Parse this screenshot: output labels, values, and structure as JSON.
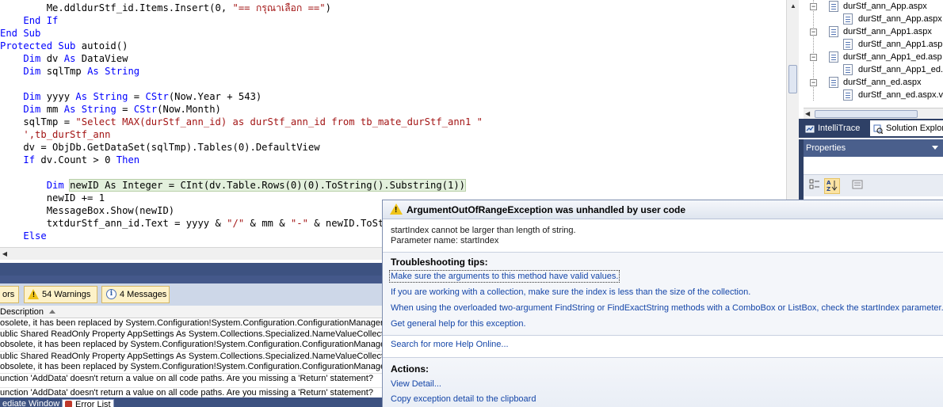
{
  "editor": {
    "lines": [
      [
        {
          "t": "        Me.ddldurStf_id.Items.Insert(0, "
        },
        {
          "t": "\"== กรุณาเลือก ==\"",
          "c": "str"
        },
        {
          "t": ")"
        }
      ],
      [
        {
          "t": "    "
        },
        {
          "t": "End If",
          "c": "kw"
        }
      ],
      [
        {
          "t": "End Sub",
          "c": "kw"
        }
      ],
      [
        {
          "t": "Protected Sub",
          "c": "kw"
        },
        {
          "t": " autoid()"
        }
      ],
      [
        {
          "t": "    "
        },
        {
          "t": "Dim",
          "c": "kw"
        },
        {
          "t": " dv "
        },
        {
          "t": "As",
          "c": "kw"
        },
        {
          "t": " DataView"
        }
      ],
      [
        {
          "t": "    "
        },
        {
          "t": "Dim",
          "c": "kw"
        },
        {
          "t": " sqlTmp "
        },
        {
          "t": "As",
          "c": "kw"
        },
        {
          "t": " "
        },
        {
          "t": "String",
          "c": "kw"
        }
      ],
      [
        {
          "t": ""
        }
      ],
      [
        {
          "t": "    "
        },
        {
          "t": "Dim",
          "c": "kw"
        },
        {
          "t": " yyyy "
        },
        {
          "t": "As",
          "c": "kw"
        },
        {
          "t": " "
        },
        {
          "t": "String",
          "c": "kw"
        },
        {
          "t": " = "
        },
        {
          "t": "CStr",
          "c": "kw"
        },
        {
          "t": "(Now.Year + 543)"
        }
      ],
      [
        {
          "t": "    "
        },
        {
          "t": "Dim",
          "c": "kw"
        },
        {
          "t": " mm "
        },
        {
          "t": "As",
          "c": "kw"
        },
        {
          "t": " "
        },
        {
          "t": "String",
          "c": "kw"
        },
        {
          "t": " = "
        },
        {
          "t": "CStr",
          "c": "kw"
        },
        {
          "t": "(Now.Month)"
        }
      ],
      [
        {
          "t": "    sqlTmp = "
        },
        {
          "t": "\"Select MAX(durStf_ann_id) as durStf_ann_id from tb_mate_durStf_ann1 \"",
          "c": "str"
        }
      ],
      [
        {
          "t": "    "
        },
        {
          "t": "',tb_durStf_ann",
          "c": "str"
        }
      ],
      [
        {
          "t": "    dv = ObjDb.GetDataSet(sqlTmp).Tables(0).DefaultView"
        }
      ],
      [
        {
          "t": "    "
        },
        {
          "t": "If",
          "c": "kw"
        },
        {
          "t": " dv.Count > 0 "
        },
        {
          "t": "Then",
          "c": "kw"
        }
      ],
      [
        {
          "t": ""
        }
      ],
      [
        {
          "t": "        "
        },
        {
          "t": "Dim",
          "c": "kw"
        },
        {
          "t": " "
        },
        {
          "t": "newID As Integer = CInt(dv.Table.Rows(0)(0).ToString().Substring(1))",
          "c": "hl"
        }
      ],
      [
        {
          "t": "        newID += 1"
        }
      ],
      [
        {
          "t": "        MessageBox.Show(newID)"
        }
      ],
      [
        {
          "t": "        txtdurStf_ann_id.Text = yyyy & "
        },
        {
          "t": "\"/\"",
          "c": "str"
        },
        {
          "t": " & mm & "
        },
        {
          "t": "\"-\"",
          "c": "str"
        },
        {
          "t": " & newID.ToStr"
        }
      ],
      [
        {
          "t": "    "
        },
        {
          "t": "Else",
          "c": "kw"
        }
      ]
    ]
  },
  "solution_explorer": {
    "items": [
      {
        "label": "durStf_ann_App.aspx",
        "toggle": "-",
        "indent": 1
      },
      {
        "label": "durStf_ann_App.aspx",
        "toggle": "",
        "indent": 2
      },
      {
        "label": "durStf_ann_App1.aspx",
        "toggle": "-",
        "indent": 1
      },
      {
        "label": "durStf_ann_App1.asp",
        "toggle": "",
        "indent": 2
      },
      {
        "label": "durStf_ann_App1_ed.asp",
        "toggle": "-",
        "indent": 1
      },
      {
        "label": "durStf_ann_App1_ed.",
        "toggle": "",
        "indent": 2
      },
      {
        "label": "durStf_ann_ed.aspx",
        "toggle": "-",
        "indent": 1
      },
      {
        "label": "durStf_ann_ed.aspx.v",
        "toggle": "",
        "indent": 2
      }
    ]
  },
  "tool_tabs": {
    "intellitrace": "IntelliTrace",
    "solution_explorer": "Solution Explor"
  },
  "properties": {
    "title": "Properties"
  },
  "error_list": {
    "errors_tab": "ors",
    "warnings_tab": "54 Warnings",
    "messages_tab": "4 Messages",
    "column_description": "Description",
    "rows": [
      [
        "osolete, it has been replaced by System.Configuration!System.Configuration.ConfigurationManager"
      ],
      [
        "ublic Shared ReadOnly Property AppSettings As System.Collections.Specialized.NameValueCollection'",
        "obsolete, it has been replaced by System.Configuration!System.Configuration.ConfigurationManager"
      ],
      [
        "ublic Shared ReadOnly Property AppSettings As System.Collections.Specialized.NameValueCollection'",
        "obsolete, it has been replaced by System.Configuration!System.Configuration.ConfigurationManager"
      ],
      [
        "unction 'AddData' doesn't return a value on all code paths. Are you missing a 'Return' statement?"
      ],
      [
        "unction 'AddData' doesn't return a value on all code paths. Are you missing a 'Return' statement?"
      ]
    ],
    "bottom_tabs": {
      "immediate": "ediate Window",
      "error_list": "Error List"
    }
  },
  "exception": {
    "title": "ArgumentOutOfRangeException was unhandled by user code",
    "message": "startIndex cannot be larger than length of string.",
    "parameter": "Parameter name: startIndex",
    "tips_title": "Troubleshooting tips:",
    "tips": [
      "Make sure the arguments to this method have valid values.",
      "If you are working with a collection, make sure the index is less than the size of the collection.",
      "When using the overloaded two-argument FindString or FindExactString methods with a ComboBox or ListBox, check the startIndex parameter.",
      "Get general help for this exception."
    ],
    "search_online": "Search for more Help Online...",
    "actions_title": "Actions:",
    "actions": [
      "View Detail...",
      "Copy exception detail to the clipboard"
    ]
  }
}
